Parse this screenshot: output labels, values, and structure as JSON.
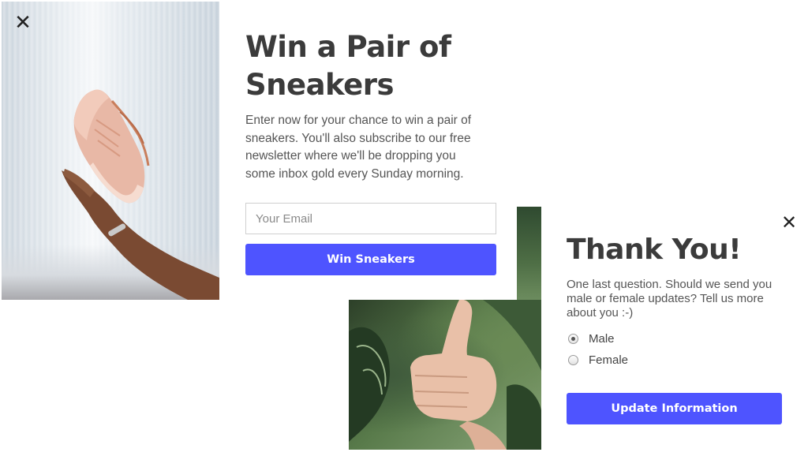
{
  "popup_signup": {
    "close_icon": "close-icon",
    "image_icon": "sneaker-photo",
    "title": "Win a Pair of Sneakers",
    "description": "Enter now for your chance to win a pair of sneakers. You'll also subscribe to our free newsletter where we'll be dropping you some inbox gold every Sunday morning.",
    "email_placeholder": "Your Email",
    "email_value": "",
    "button_label": "Win Sneakers"
  },
  "popup_thanks": {
    "close_icon": "close-icon",
    "image_icon": "thumbs-up-photo",
    "title": "Thank You!",
    "description": "One last question. Should we send you male or female updates? Tell us more about you :-)",
    "options": [
      {
        "label": "Male",
        "selected": true
      },
      {
        "label": "Female",
        "selected": false
      }
    ],
    "button_label": "Update Information"
  },
  "colors": {
    "accent": "#4e54ff",
    "heading": "#3b3b3b",
    "body_text": "#555555"
  }
}
